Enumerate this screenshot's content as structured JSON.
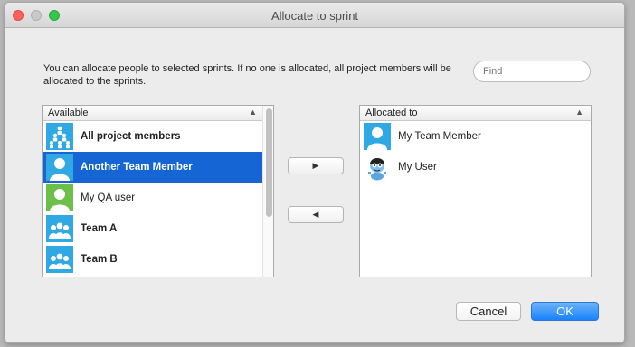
{
  "window": {
    "title": "Allocate to sprint"
  },
  "description": "You can allocate people to selected sprints. If no one is allocated, all project members will be allocated to the sprints.",
  "find": {
    "placeholder": "Find",
    "value": ""
  },
  "available": {
    "header": "Available",
    "sort_icon": "▲",
    "items": [
      {
        "label": "All project members",
        "icon": "group-hierarchy-icon",
        "bold": true,
        "selected": false
      },
      {
        "label": "Another Team Member",
        "icon": "person-icon",
        "bold": true,
        "selected": true
      },
      {
        "label": "My QA user",
        "icon": "person-green-icon",
        "bold": false,
        "selected": false
      },
      {
        "label": "Team A",
        "icon": "team-icon",
        "bold": true,
        "selected": false
      },
      {
        "label": "Team B",
        "icon": "team-icon",
        "bold": true,
        "selected": false
      }
    ]
  },
  "allocated": {
    "header": "Allocated to",
    "sort_icon": "▲",
    "items": [
      {
        "label": "My Team Member",
        "icon": "person-icon"
      },
      {
        "label": "My User",
        "icon": "cartoon-avatar-icon"
      }
    ]
  },
  "buttons": {
    "add": "▶",
    "remove": "◀",
    "cancel": "Cancel",
    "ok": "OK"
  },
  "colors": {
    "selection": "#1565d4",
    "avatar_blue": "#2fa8e4",
    "avatar_green": "#6cc04a",
    "ok_button": "#1a82fb"
  }
}
